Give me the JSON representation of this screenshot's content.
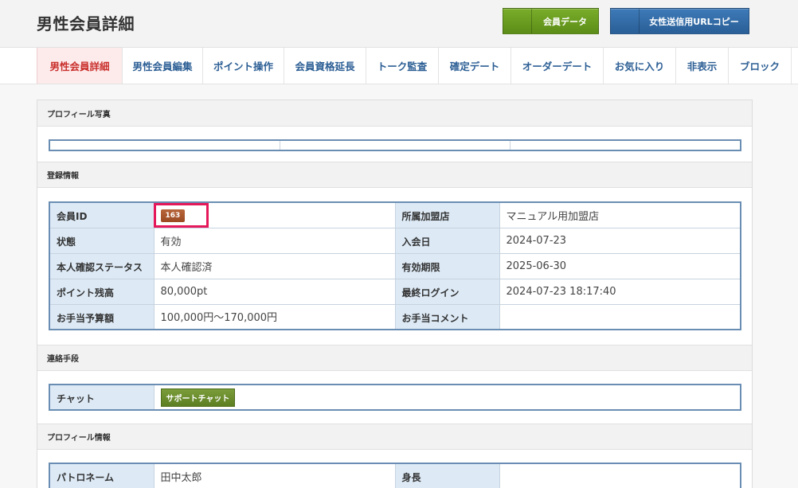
{
  "header": {
    "title": "男性会員詳細",
    "member_data_button": "会員データ",
    "female_url_copy_button": "女性送信用URLコピー"
  },
  "tabs": [
    {
      "label": "男性会員詳細",
      "active": true
    },
    {
      "label": "男性会員編集"
    },
    {
      "label": "ポイント操作"
    },
    {
      "label": "会員資格延長"
    },
    {
      "label": "トーク監査"
    },
    {
      "label": "確定デート"
    },
    {
      "label": "オーダーデート"
    },
    {
      "label": "お気に入り"
    },
    {
      "label": "非表示"
    },
    {
      "label": "ブロック"
    }
  ],
  "sections": {
    "profile_photo": "プロフィール写真",
    "registration_info": "登録情報",
    "contact_method": "連絡手段",
    "profile_info": "プロフィール情報"
  },
  "registration": {
    "member_id_label": "会員ID",
    "member_id_value": "163",
    "store_label": "所属加盟店",
    "store_value": "マニュアル用加盟店",
    "status_label": "状態",
    "status_value": "有効",
    "join_date_label": "入会日",
    "join_date_value": "2024-07-23",
    "verification_label": "本人確認ステータス",
    "verification_value": "本人確認済",
    "expiry_label": "有効期限",
    "expiry_value": "2025-06-30",
    "points_label": "ポイント残高",
    "points_value": "80,000pt",
    "last_login_label": "最終ログイン",
    "last_login_value": "2024-07-23 18:17:40",
    "allowance_budget_label": "お手当予算額",
    "allowance_budget_value": "100,000円〜170,000円",
    "allowance_comment_label": "お手当コメント",
    "allowance_comment_value": ""
  },
  "contact": {
    "chat_label": "チャット",
    "support_chat_button": "サポートチャット"
  },
  "profile": {
    "patron_name_label": "パトロネーム",
    "patron_name_value": "田中太郎",
    "height_label": "身長",
    "height_value": ""
  },
  "colors": {
    "tab_text": "#2d5f95",
    "active_tab_bg": "#fdeaea",
    "table_border": "#6a8eb3",
    "label_bg": "#ddeaf6",
    "highlight": "#e4185b"
  }
}
